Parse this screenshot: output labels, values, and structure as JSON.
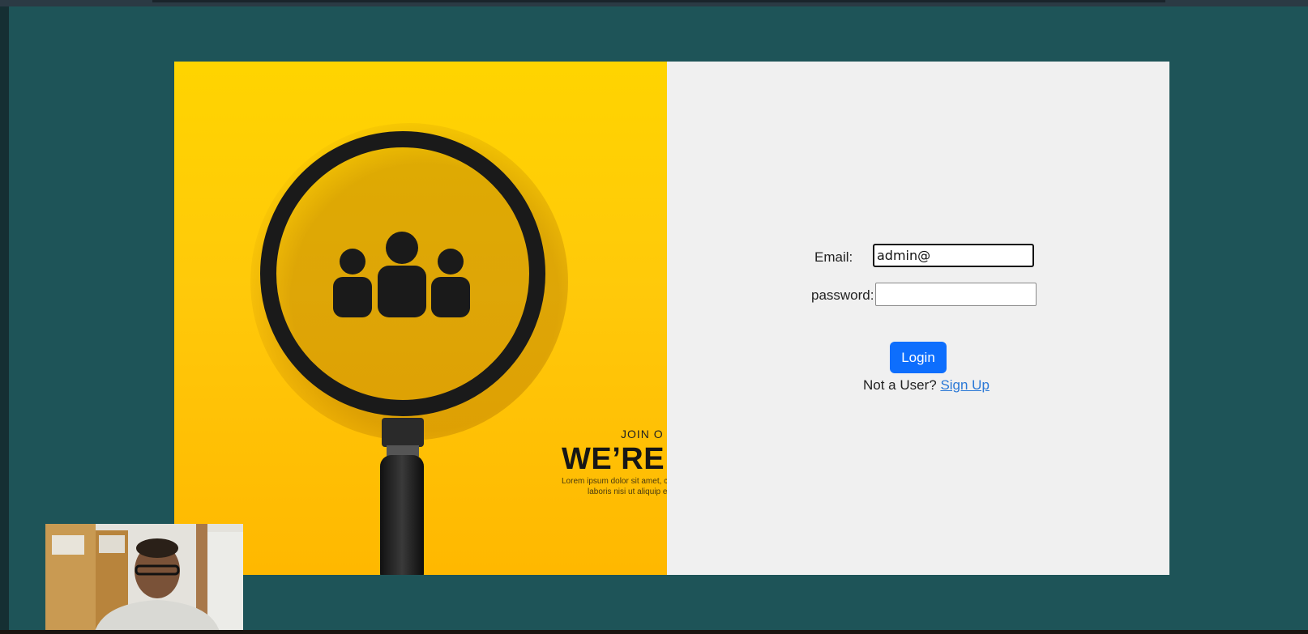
{
  "promo": {
    "join_text": "JOIN O",
    "headline": "WE’RE",
    "lorem_line1": "Lorem ipsum dolor sit amet, c",
    "lorem_line2": "laboris nisi ut aliquip e",
    "background": "#ffc90a"
  },
  "login_form": {
    "email_label": "Email:",
    "email_value": "admin@",
    "password_label": "password:",
    "password_value": "",
    "login_button": "Login",
    "prompt_text": "Not a User?",
    "signup_link": "Sign Up",
    "button_color": "#0d6efd",
    "link_color": "#2a78d6"
  },
  "page": {
    "background": "#1e5458",
    "form_background": "#f0f0f0"
  }
}
